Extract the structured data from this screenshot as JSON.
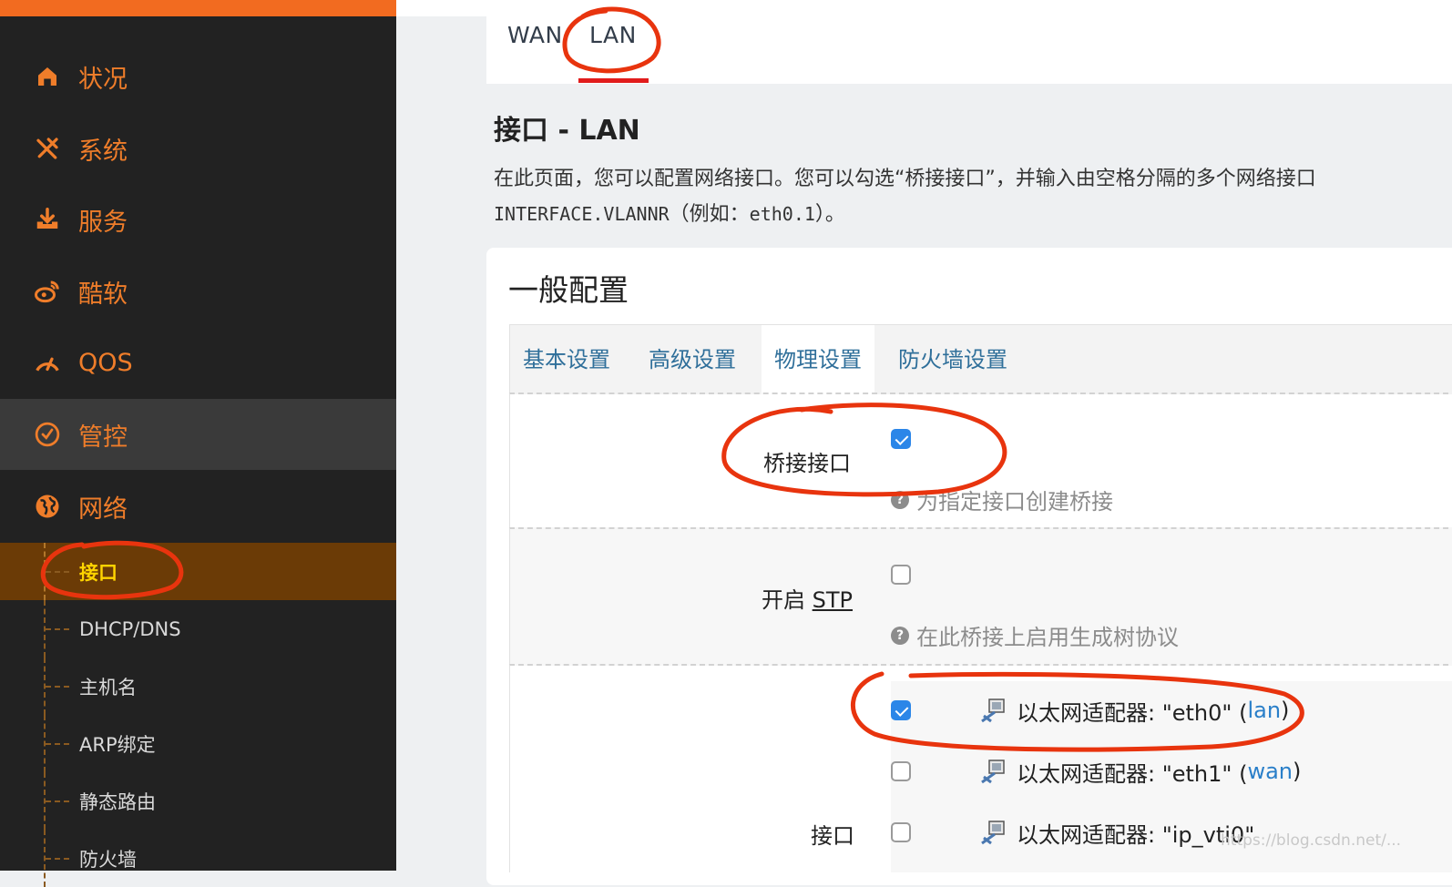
{
  "sidebar": {
    "items": [
      {
        "label": "状况",
        "icon": "home-icon"
      },
      {
        "label": "系统",
        "icon": "tools-icon"
      },
      {
        "label": "服务",
        "icon": "download-icon"
      },
      {
        "label": "酷软",
        "icon": "weibo-icon"
      },
      {
        "label": "QOS",
        "icon": "speedometer-icon"
      },
      {
        "label": "管控",
        "icon": "check-circle-icon"
      },
      {
        "label": "网络",
        "icon": "globe-icon"
      }
    ],
    "subitems": [
      {
        "label": "接口"
      },
      {
        "label": "DHCP/DNS"
      },
      {
        "label": "主机名"
      },
      {
        "label": "ARP绑定"
      },
      {
        "label": "静态路由"
      },
      {
        "label": "防火墙"
      }
    ]
  },
  "tabs": [
    {
      "label": "WAN"
    },
    {
      "label": "LAN"
    }
  ],
  "page": {
    "title": "接口 - LAN",
    "desc_line1": "在此页面，您可以配置网络接口。您可以勾选“桥接接口”，并输入由空格分隔的多个网络接口",
    "desc_line2_code": "INTERFACE.VLANNR",
    "desc_line2_mid": "（例如：",
    "desc_line2_code2": "eth0.1",
    "desc_line2_end": "）。"
  },
  "section": {
    "title": "一般配置",
    "tabs": [
      {
        "label": "基本设置"
      },
      {
        "label": "高级设置"
      },
      {
        "label": "物理设置"
      },
      {
        "label": "防火墙设置"
      }
    ]
  },
  "fields": {
    "bridge": {
      "label": "桥接接口",
      "hint": "为指定接口创建桥接",
      "checked": true
    },
    "stp": {
      "label_prefix": "开启 ",
      "label_abbr": "STP",
      "hint": "在此桥接上启用生成树协议",
      "checked": false
    },
    "iface": {
      "label": "接口",
      "options": [
        {
          "text": "以太网适配器: \"eth0\" (",
          "net": "lan",
          "close": ")",
          "checked": true
        },
        {
          "text": "以太网适配器: \"eth1\" (",
          "net": "wan",
          "close": ")",
          "checked": false
        },
        {
          "text": "以太网适配器: \"ip_vti0\"",
          "net": "",
          "close": "",
          "checked": false
        }
      ]
    }
  },
  "watermark": "https://blog.csdn.net/...",
  "colors": {
    "accent": "#ef7d2a",
    "selected_bg": "#6b3b06",
    "selected_text": "#ffd400",
    "link": "#2a7fc9",
    "annotation": "#e8340e"
  }
}
